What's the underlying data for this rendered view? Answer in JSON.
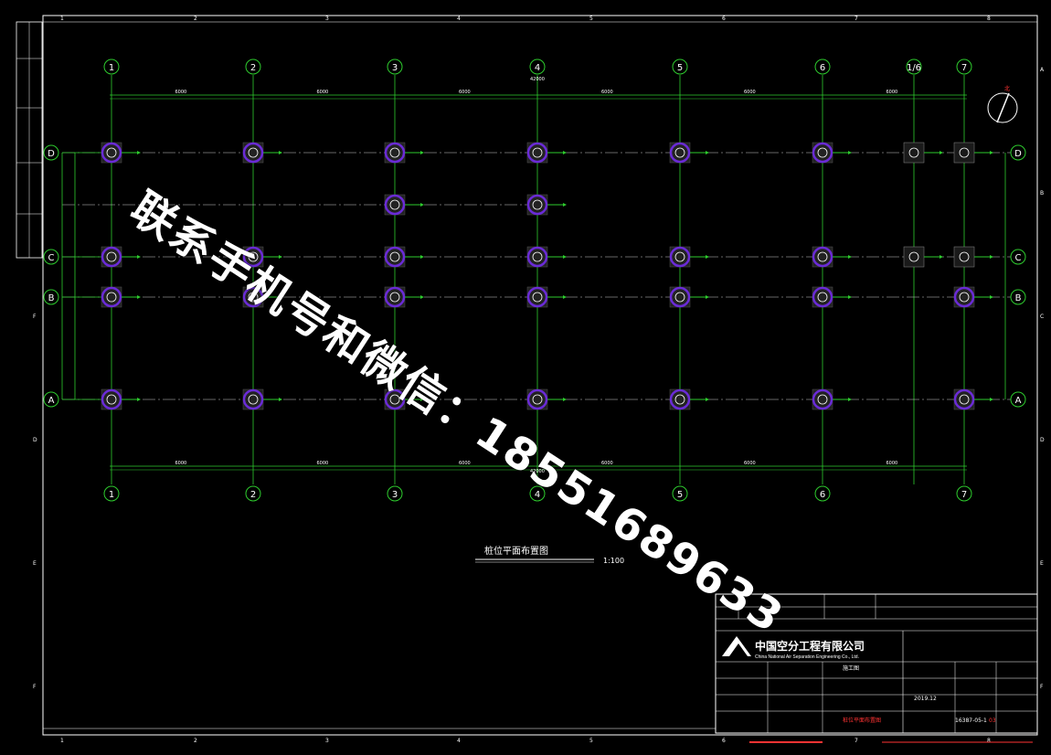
{
  "drawing": {
    "columns": [
      "1",
      "2",
      "3",
      "4",
      "5",
      "6",
      "1/6",
      "7"
    ],
    "bottom_columns": [
      "1",
      "2",
      "3",
      "4",
      "5",
      "6",
      "7"
    ],
    "rows": [
      "D",
      "C",
      "B",
      "A"
    ],
    "border_numbers": [
      "1",
      "2",
      "3",
      "4",
      "5",
      "6",
      "7",
      "8"
    ],
    "border_letters_right": [
      "A",
      "B",
      "C",
      "D",
      "E",
      "F"
    ],
    "border_letters_left": [
      "F",
      "D",
      "E",
      "F"
    ],
    "dim_top_total": "42000",
    "dim_bottom_total": "42000",
    "dim_top_segments": [
      "6000",
      "6000",
      "6000",
      "6000",
      "6000",
      "6000"
    ],
    "dim_bottom_segments": [
      "6000",
      "6000",
      "6000",
      "6000",
      "6000",
      "6000"
    ],
    "plan_title": "桩位平面布置图",
    "plan_scale": "1:100",
    "north": "北"
  },
  "watermark": {
    "text": "联系手机号和微信：18551689633"
  },
  "title_block": {
    "company_cn": "中国空分工程有限公司",
    "company_en": "China National Air Separation Engineering Co., Ltd.",
    "drawing_name": "桩位平面布置图",
    "drawing_no": "16387-05-1",
    "sheet": "03",
    "date": "2019.12",
    "stage": "施工图"
  }
}
